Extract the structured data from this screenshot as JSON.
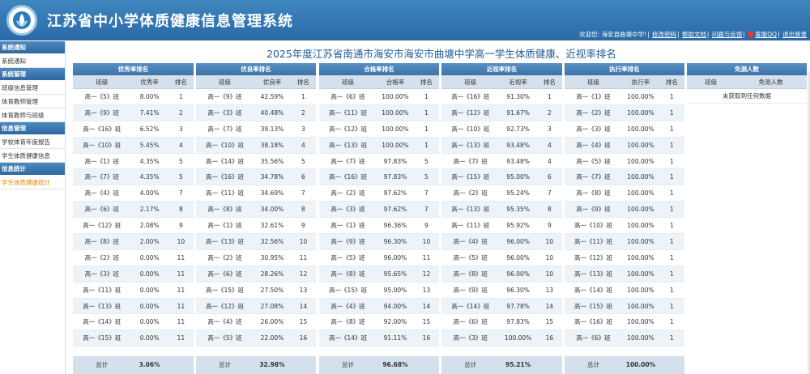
{
  "header": {
    "title": "江苏省中小学体质健康信息管理系统",
    "welcome": "欢迎您: 海安县曲塘中学!",
    "links": [
      "修改密码",
      "帮助文档",
      "问题与反馈",
      "客服QQ",
      "退出登录"
    ]
  },
  "sidebar": {
    "sections": [
      {
        "title": "系统通知",
        "items": [
          "系统通知"
        ]
      },
      {
        "title": "系统管理",
        "items": [
          "班级信息管理",
          "体育教师管理",
          "体育教师与班级"
        ]
      },
      {
        "title": "信息管理",
        "items": [
          "学校体育年度报告",
          "学生体质健康信息"
        ]
      },
      {
        "title": "信息统计",
        "items": [
          "学生体质健康统计"
        ]
      }
    ]
  },
  "page_title": "2025年度江苏省南通市海安市海安市曲塘中学高一学生体质健康、近视率排名",
  "col_class": "班级",
  "col_rank": "排名",
  "total_label": "总计",
  "panels": [
    {
      "title": "优秀率排名",
      "rate_label": "优秀率",
      "total": "3.06%",
      "rows": [
        [
          "高一《5》班",
          "8.00%",
          "1"
        ],
        [
          "高一《9》班",
          "7.41%",
          "2"
        ],
        [
          "高一《16》班",
          "6.52%",
          "3"
        ],
        [
          "高一《10》班",
          "5.45%",
          "4"
        ],
        [
          "高一《1》班",
          "4.35%",
          "5"
        ],
        [
          "高一《7》班",
          "4.35%",
          "5"
        ],
        [
          "高一《4》班",
          "4.00%",
          "7"
        ],
        [
          "高一《6》班",
          "2.17%",
          "8"
        ],
        [
          "高一《12》班",
          "2.08%",
          "9"
        ],
        [
          "高一《8》班",
          "2.00%",
          "10"
        ],
        [
          "高一《2》班",
          "0.00%",
          "11"
        ],
        [
          "高一《3》班",
          "0.00%",
          "11"
        ],
        [
          "高一《11》班",
          "0.00%",
          "11"
        ],
        [
          "高一《13》班",
          "0.00%",
          "11"
        ],
        [
          "高一《14》班",
          "0.00%",
          "11"
        ],
        [
          "高一《15》班",
          "0.00%",
          "11"
        ]
      ]
    },
    {
      "title": "优良率排名",
      "rate_label": "优良率",
      "total": "32.98%",
      "rows": [
        [
          "高一《9》班",
          "42.59%",
          "1"
        ],
        [
          "高一《3》班",
          "40.48%",
          "2"
        ],
        [
          "高一《7》班",
          "39.13%",
          "3"
        ],
        [
          "高一《10》班",
          "38.18%",
          "4"
        ],
        [
          "高一《14》班",
          "35.56%",
          "5"
        ],
        [
          "高一《16》班",
          "34.78%",
          "6"
        ],
        [
          "高一《11》班",
          "34.69%",
          "7"
        ],
        [
          "高一《8》班",
          "34.00%",
          "8"
        ],
        [
          "高一《1》班",
          "32.61%",
          "9"
        ],
        [
          "高一《13》班",
          "32.56%",
          "10"
        ],
        [
          "高一《2》班",
          "30.95%",
          "11"
        ],
        [
          "高一《6》班",
          "28.26%",
          "12"
        ],
        [
          "高一《15》班",
          "27.50%",
          "13"
        ],
        [
          "高一《12》班",
          "27.08%",
          "14"
        ],
        [
          "高一《4》班",
          "26.00%",
          "15"
        ],
        [
          "高一《5》班",
          "22.00%",
          "16"
        ]
      ]
    },
    {
      "title": "合格率排名",
      "rate_label": "合格率",
      "total": "96.68%",
      "rows": [
        [
          "高一《6》班",
          "100.00%",
          "1"
        ],
        [
          "高一《11》班",
          "100.00%",
          "1"
        ],
        [
          "高一《12》班",
          "100.00%",
          "1"
        ],
        [
          "高一《13》班",
          "100.00%",
          "1"
        ],
        [
          "高一《7》班",
          "97.83%",
          "5"
        ],
        [
          "高一《16》班",
          "97.83%",
          "5"
        ],
        [
          "高一《2》班",
          "97.62%",
          "7"
        ],
        [
          "高一《3》班",
          "97.62%",
          "7"
        ],
        [
          "高一《1》班",
          "96.36%",
          "9"
        ],
        [
          "高一《9》班",
          "96.30%",
          "10"
        ],
        [
          "高一《5》班",
          "96.00%",
          "11"
        ],
        [
          "高一《8》班",
          "95.65%",
          "12"
        ],
        [
          "高一《15》班",
          "95.00%",
          "13"
        ],
        [
          "高一《4》班",
          "94.00%",
          "14"
        ],
        [
          "高一《8》班",
          "92.00%",
          "15"
        ],
        [
          "高一《14》班",
          "91.11%",
          "16"
        ]
      ]
    },
    {
      "title": "近视率排名",
      "rate_label": "近视率",
      "total": "95.21%",
      "rows": [
        [
          "高一《16》班",
          "91.30%",
          "1"
        ],
        [
          "高一《12》班",
          "91.67%",
          "2"
        ],
        [
          "高一《10》班",
          "92.73%",
          "3"
        ],
        [
          "高一《13》班",
          "93.48%",
          "4"
        ],
        [
          "高一《7》班",
          "93.48%",
          "4"
        ],
        [
          "高一《15》班",
          "95.00%",
          "6"
        ],
        [
          "高一《2》班",
          "95.24%",
          "7"
        ],
        [
          "高一《13》班",
          "95.35%",
          "8"
        ],
        [
          "高一《11》班",
          "95.92%",
          "9"
        ],
        [
          "高一《4》班",
          "96.00%",
          "10"
        ],
        [
          "高一《5》班",
          "96.00%",
          "10"
        ],
        [
          "高一《8》班",
          "96.00%",
          "10"
        ],
        [
          "高一《9》班",
          "96.30%",
          "13"
        ],
        [
          "高一《14》班",
          "97.78%",
          "14"
        ],
        [
          "高一《6》班",
          "97.83%",
          "15"
        ],
        [
          "高一《3》班",
          "100.00%",
          "16"
        ]
      ]
    },
    {
      "title": "执行率排名",
      "rate_label": "执行率",
      "total": "100.00%",
      "rows": [
        [
          "高一《1》班",
          "100.00%",
          "1"
        ],
        [
          "高一《2》班",
          "100.00%",
          "1"
        ],
        [
          "高一《3》班",
          "100.00%",
          "1"
        ],
        [
          "高一《4》班",
          "100.00%",
          "1"
        ],
        [
          "高一《5》班",
          "100.00%",
          "1"
        ],
        [
          "高一《7》班",
          "100.00%",
          "1"
        ],
        [
          "高一《8》班",
          "100.00%",
          "1"
        ],
        [
          "高一《9》班",
          "100.00%",
          "1"
        ],
        [
          "高一《10》班",
          "100.00%",
          "1"
        ],
        [
          "高一《11》班",
          "100.00%",
          "1"
        ],
        [
          "高一《12》班",
          "100.00%",
          "1"
        ],
        [
          "高一《13》班",
          "100.00%",
          "1"
        ],
        [
          "高一《14》班",
          "100.00%",
          "1"
        ],
        [
          "高一《15》班",
          "100.00%",
          "1"
        ],
        [
          "高一《16》班",
          "100.00%",
          "1"
        ],
        [
          "高一《6》班",
          "100.00%",
          "1"
        ]
      ]
    }
  ],
  "exempt": {
    "title": "免测人数",
    "col_class": "班级",
    "col_count": "免测人数",
    "empty_text": "未获取到任何数据"
  },
  "colors": {
    "header_blue": "#2a6aa6",
    "title_blue": "#1f5a93",
    "active_item": "#e08a00"
  }
}
